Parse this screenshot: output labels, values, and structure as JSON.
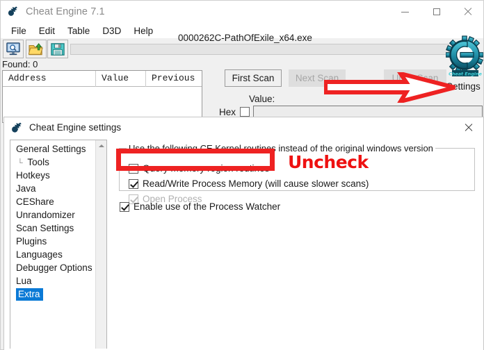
{
  "main_window": {
    "title": "Cheat Engine 7.1",
    "title_icon": "cheat-engine-logo-icon",
    "window_controls": {
      "minimize": "minimize-icon",
      "maximize": "maximize-icon",
      "close": "close-icon"
    },
    "menu": [
      {
        "label": "File"
      },
      {
        "label": "Edit"
      },
      {
        "label": "Table"
      },
      {
        "label": "D3D"
      },
      {
        "label": "Help"
      }
    ],
    "toolbar": {
      "open_process_icon": "monitor-magnifier-icon",
      "load_table_icon": "folder-open-icon",
      "save_table_icon": "floppy-disk-icon"
    },
    "process_name": "0000262C-PathOfExile_x64.exe",
    "found_label": "Found: 0",
    "address_table": {
      "columns": [
        "Address",
        "Value",
        "Previous"
      ],
      "rows": []
    },
    "scan_buttons": {
      "first_scan": "First Scan",
      "next_scan": "Next Scan",
      "undo_scan": "Undo Scan"
    },
    "value_label": "Value:",
    "hex_label": "Hex",
    "hex_checked": false,
    "value_input": "",
    "settings_link": "Settings",
    "logo_icon": "cheat-engine-logo-icon",
    "logo_caption": "Cheat Engine"
  },
  "settings_dialog": {
    "title": "Cheat Engine settings",
    "title_icon": "cheat-engine-logo-icon",
    "close_icon": "close-icon",
    "tree": {
      "scroll_up_icon": "chevron-up-icon",
      "items": [
        {
          "label": "General Settings",
          "selected": false,
          "child": false
        },
        {
          "label": "Tools",
          "selected": false,
          "child": true
        },
        {
          "label": "Hotkeys",
          "selected": false,
          "child": false
        },
        {
          "label": "Java",
          "selected": false,
          "child": false
        },
        {
          "label": "CEShare",
          "selected": false,
          "child": false
        },
        {
          "label": "Unrandomizer",
          "selected": false,
          "child": false
        },
        {
          "label": "Scan Settings",
          "selected": false,
          "child": false
        },
        {
          "label": "Plugins",
          "selected": false,
          "child": false
        },
        {
          "label": "Languages",
          "selected": false,
          "child": false
        },
        {
          "label": "Debugger Options",
          "selected": false,
          "child": false
        },
        {
          "label": "Lua",
          "selected": false,
          "child": false
        },
        {
          "label": "Extra",
          "selected": true,
          "child": false
        }
      ]
    },
    "group_title": "Use the following CE Kernel routines instead of the original windows version",
    "options": {
      "query_memory": {
        "label": "Query memory region routines",
        "checked": false,
        "disabled": false
      },
      "read_write_memory": {
        "label": "Read/Write Process Memory  (will cause slower scans)",
        "checked": true,
        "disabled": false
      },
      "open_process": {
        "label": "Open Process",
        "checked": true,
        "disabled": true
      },
      "process_watcher": {
        "label": "Enable use of the Process Watcher",
        "checked": true,
        "disabled": false
      }
    }
  },
  "annotations": {
    "uncheck_text": "Uncheck",
    "highlight_color": "#ee2222",
    "arrow": "right-arrow-annotation",
    "rectangle": "highlight-rectangle-annotation"
  }
}
